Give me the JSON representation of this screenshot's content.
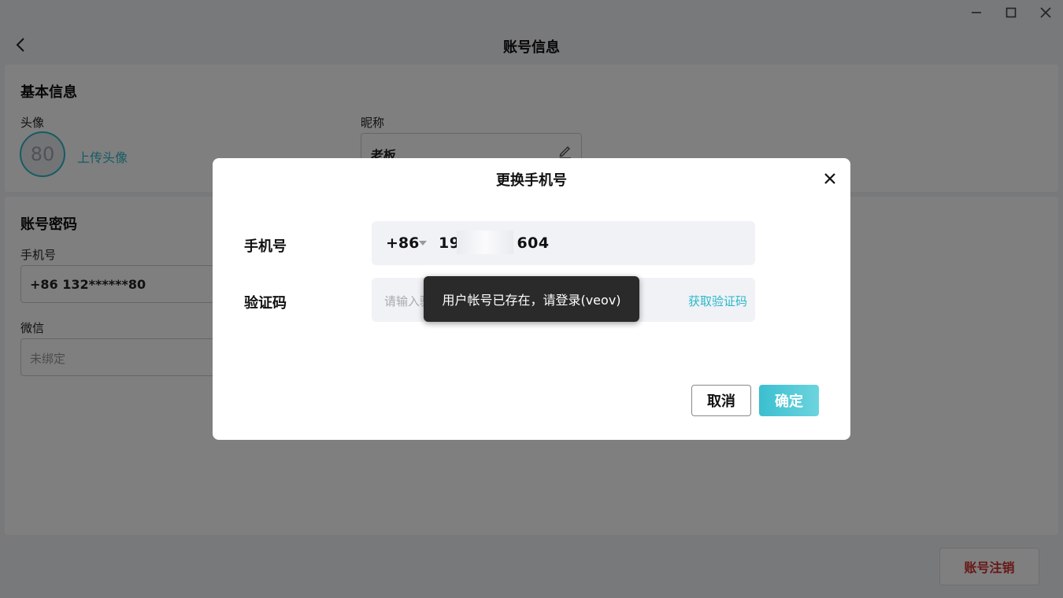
{
  "window": {
    "minimize_icon": "minimize-icon",
    "maximize_icon": "maximize-icon",
    "close_icon": "close-icon"
  },
  "header": {
    "title": "账号信息",
    "back_icon": "chevron-left-icon"
  },
  "basic_info": {
    "title": "基本信息",
    "avatar_label": "头像",
    "avatar_text": "80",
    "upload_label": "上传头像",
    "nickname_label": "昵称",
    "nickname_value": "老板"
  },
  "account": {
    "title": "账号密码",
    "phone_label": "手机号",
    "phone_value": "+86 132******80",
    "wechat_label": "微信",
    "wechat_value": "未绑定"
  },
  "delete_account_label": "账号注销",
  "modal": {
    "title": "更换手机号",
    "phone_label": "手机号",
    "country_code": "+86",
    "phone_prefix": "19",
    "phone_suffix": "604",
    "code_label": "验证码",
    "code_placeholder": "请输入验证码",
    "get_code_label": "获取验证码",
    "cancel_label": "取消",
    "confirm_label": "确定"
  },
  "toast": {
    "message": "用户帐号已存在，请登录(veov)"
  },
  "colors": {
    "accent": "#2bb8c9",
    "danger": "#d0312d",
    "toast_bg": "#2a2a2a"
  }
}
